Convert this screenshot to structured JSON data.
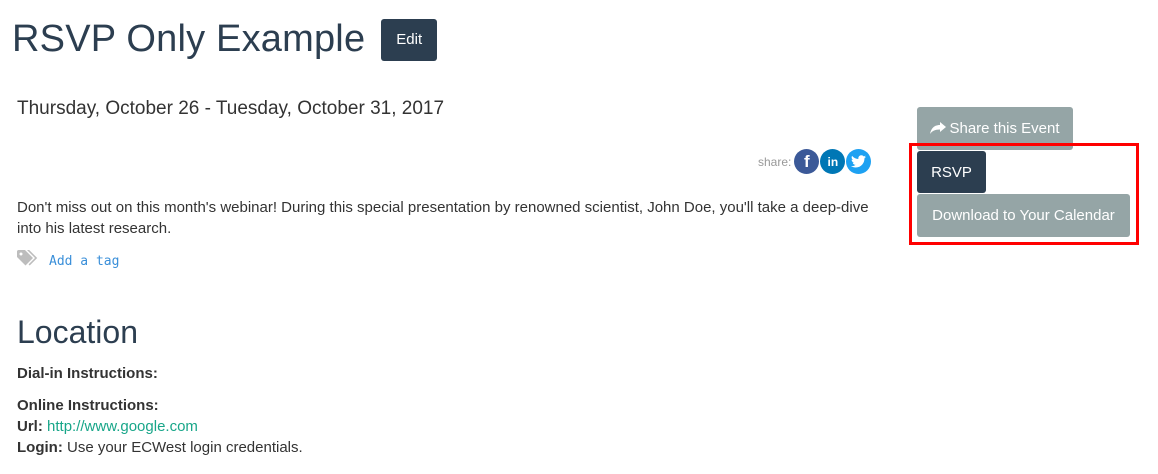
{
  "event": {
    "title": "RSVP Only Example",
    "edit_label": "Edit",
    "date_range": "Thursday, October 26 - Tuesday, October 31, 2017",
    "share_label": "share:",
    "social": {
      "facebook_glyph": "f",
      "linkedin_glyph": "in"
    },
    "description": "Don't miss out on this month's webinar! During this special presentation by renowned scientist, John Doe, you'll take a deep-dive into his latest research.",
    "add_tag_label": "Add a tag"
  },
  "actions": {
    "share_event_label": "Share this Event",
    "rsvp_label": "RSVP",
    "download_calendar_label": "Download to Your Calendar"
  },
  "location": {
    "heading": "Location",
    "dial_in_label": "Dial-in Instructions:",
    "online_label": "Online Instructions:",
    "url_label": "Url:",
    "url_value": "http://www.google.com",
    "login_label": "Login:",
    "login_value": "Use your ECWest login credentials."
  },
  "colors": {
    "primary_dark": "#2c3e50",
    "muted_button": "#95a5a6",
    "link_green": "#18a689",
    "link_blue": "#3a8fd9",
    "highlight_red": "#ff0000",
    "facebook": "#3b5998",
    "linkedin": "#0077b5",
    "twitter": "#1da1f2"
  },
  "icons": {
    "share": "share-arrow-icon",
    "tag": "tags-icon",
    "facebook": "facebook-icon",
    "linkedin": "linkedin-icon",
    "twitter": "twitter-icon"
  }
}
